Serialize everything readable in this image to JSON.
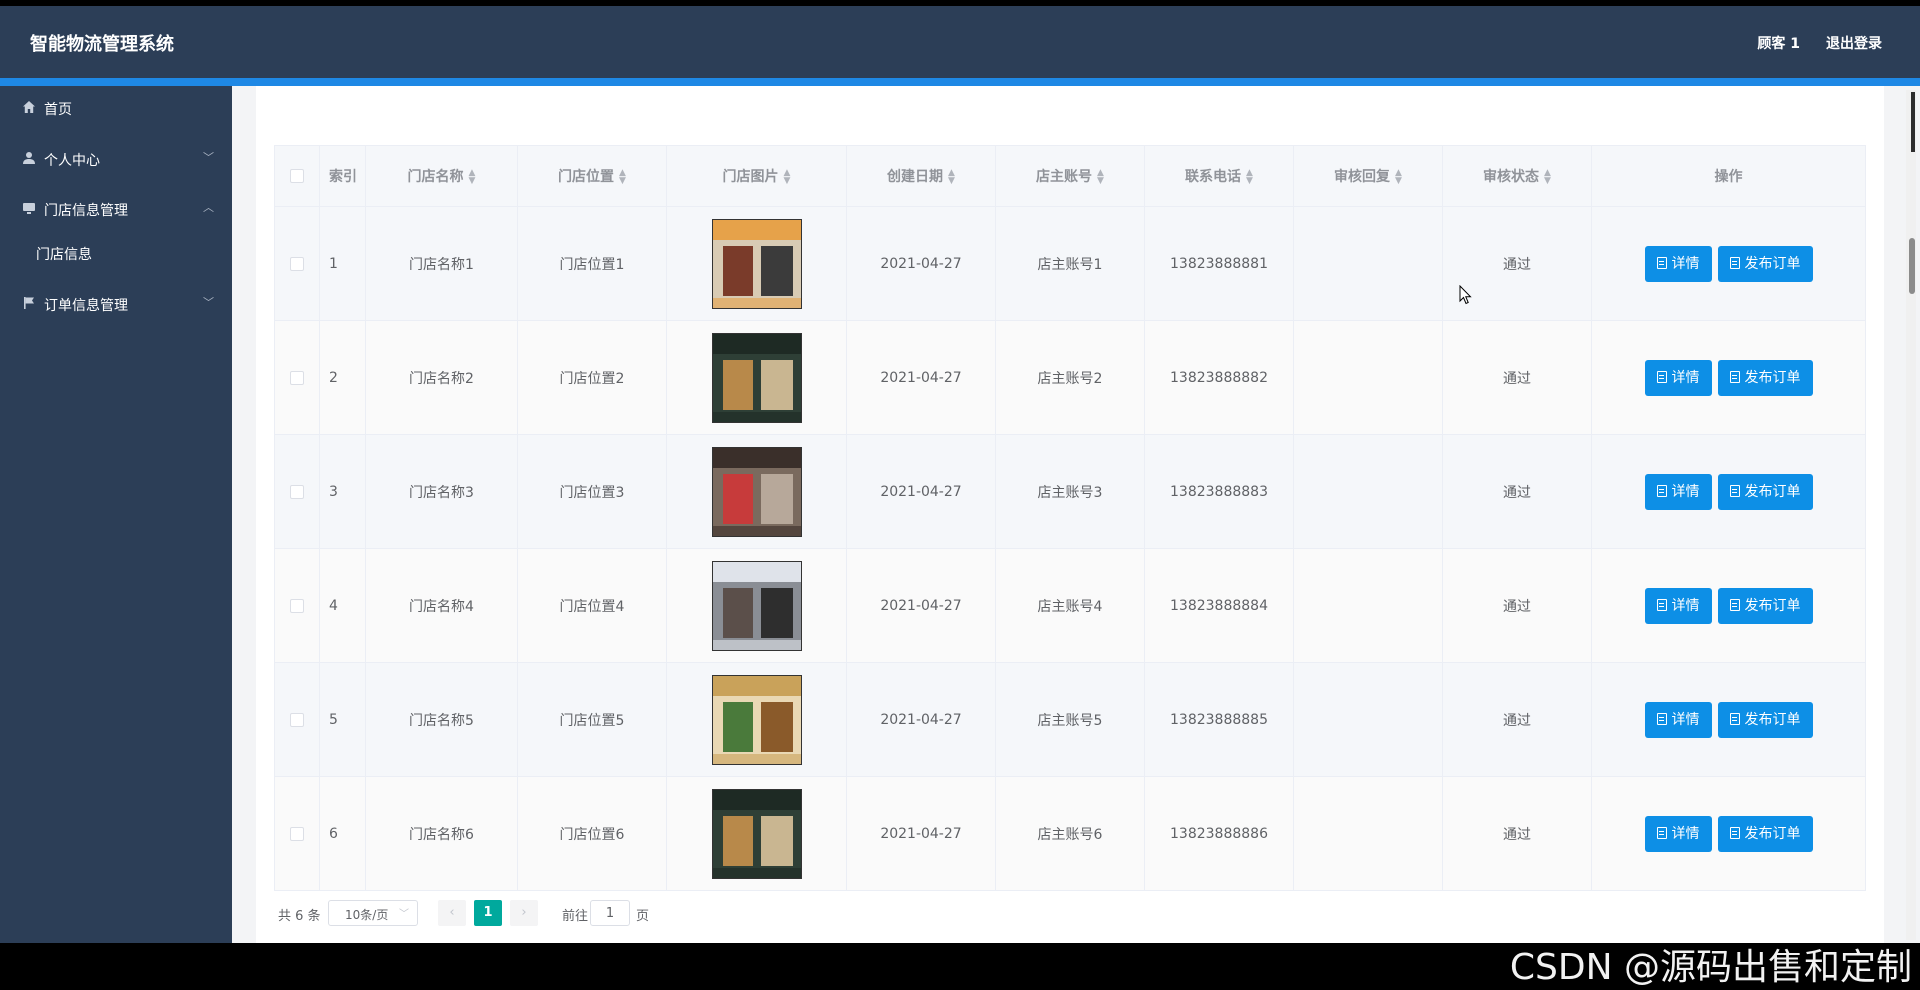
{
  "header": {
    "title": "智能物流管理系统",
    "user": "顾客 1",
    "logout": "退出登录"
  },
  "sidebar": {
    "items": [
      {
        "label": "首页",
        "icon": "home-icon"
      },
      {
        "label": "个人中心",
        "icon": "user-icon"
      },
      {
        "label": "门店信息管理",
        "icon": "monitor-icon"
      },
      {
        "label": "订单信息管理",
        "icon": "flag-icon"
      }
    ],
    "submenu": {
      "label": "门店信息"
    }
  },
  "table": {
    "headers": {
      "index": "索引",
      "name": "门店名称",
      "location": "门店位置",
      "image": "门店图片",
      "date": "创建日期",
      "account": "店主账号",
      "phone": "联系电话",
      "reply": "审核回复",
      "status": "审核状态",
      "actions": "操作"
    },
    "rows": [
      {
        "index": "1",
        "name": "门店名称1",
        "location": "门店位置1",
        "date": "2021-04-27",
        "account": "店主账号1",
        "phone": "13823888881",
        "reply": "",
        "status": "通过"
      },
      {
        "index": "2",
        "name": "门店名称2",
        "location": "门店位置2",
        "date": "2021-04-27",
        "account": "店主账号2",
        "phone": "13823888882",
        "reply": "",
        "status": "通过"
      },
      {
        "index": "3",
        "name": "门店名称3",
        "location": "门店位置3",
        "date": "2021-04-27",
        "account": "店主账号3",
        "phone": "13823888883",
        "reply": "",
        "status": "通过"
      },
      {
        "index": "4",
        "name": "门店名称4",
        "location": "门店位置4",
        "date": "2021-04-27",
        "account": "店主账号4",
        "phone": "13823888884",
        "reply": "",
        "status": "通过"
      },
      {
        "index": "5",
        "name": "门店名称5",
        "location": "门店位置5",
        "date": "2021-04-27",
        "account": "店主账号5",
        "phone": "13823888885",
        "reply": "",
        "status": "通过"
      },
      {
        "index": "6",
        "name": "门店名称6",
        "location": "门店位置6",
        "date": "2021-04-27",
        "account": "店主账号6",
        "phone": "13823888886",
        "reply": "",
        "status": "通过"
      }
    ],
    "detail_label": "详情",
    "publish_label": "发布订单"
  },
  "pagination": {
    "total": "共 6 条",
    "page_size": "10条/页",
    "prev": "‹",
    "current": "1",
    "next": "›",
    "goto": "前往",
    "goto_value": "1",
    "page_word": "页"
  },
  "watermark": "CSDN @源码出售和定制",
  "colors": {
    "header_bg": "#2c3e57",
    "accent": "#1e88e5",
    "button": "#0d8fe6",
    "current_page": "#00a99d"
  }
}
